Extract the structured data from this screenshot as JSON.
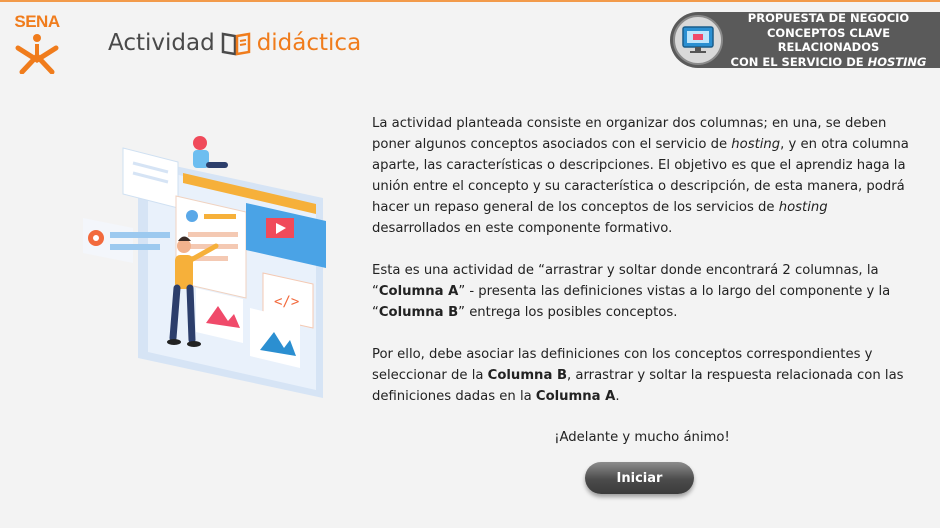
{
  "header": {
    "logo_text": "SENA",
    "activity_main": "Actividad",
    "activity_accent": "didáctica",
    "badge_lines": [
      "Propuesta de negocio",
      "Conceptos clave relacionados",
      "con el servicio de"
    ],
    "badge_italic": "hosting"
  },
  "intro": {
    "p1_a": "La actividad planteada consiste en organizar dos columnas; en una, se deben poner algunos conceptos asociados con el servicio de ",
    "p1_i1": "hosting",
    "p1_b": ", y en otra columna aparte, las características o descripciones. El objetivo es que el aprendiz haga la unión entre el concepto y su característica o descripción, de esta manera, podrá hacer un repaso general de los conceptos de los servicios de ",
    "p1_i2": "hosting",
    "p1_c": " desarrollados en este componente formativo.",
    "p2_a": "Esta es una actividad de “arrastrar y soltar donde encontrará 2 columnas, la “",
    "p2_b1": "Columna A",
    "p2_b": "” - presenta las definiciones vistas a lo largo del componente y la “",
    "p2_b2": "Columna B",
    "p2_c": "” entrega los posibles conceptos.",
    "p3_a": "Por ello, debe asociar las definiciones con los conceptos correspondientes y seleccionar de la ",
    "p3_b1": "Columna B",
    "p3_b": ", arrastrar y soltar la respuesta relacionada con las definiciones dadas en la ",
    "p3_b2": "Columna A",
    "p3_c": "."
  },
  "cheer": "¡Adelante y mucho ánimo!",
  "start_button": "Iniciar",
  "colors": {
    "accent": "#f07c1c",
    "badge_bg": "#5a5a5a",
    "button": "#4b4b4b"
  },
  "icons": [
    "sena-logo",
    "book-icon",
    "monitor-icon",
    "activity-illustration"
  ]
}
